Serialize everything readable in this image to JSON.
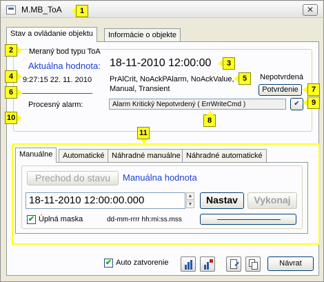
{
  "window": {
    "title": "M.MB_ToA",
    "close_glyph": "✕"
  },
  "callouts": [
    "1",
    "2",
    "3",
    "4",
    "5",
    "6",
    "7",
    "8",
    "9",
    "10",
    "11"
  ],
  "top_tabs": [
    {
      "label": "Stav a ovládanie objektu"
    },
    {
      "label": "Informácie o objekte"
    }
  ],
  "object": {
    "name_label": "Meraný bod typu ToA",
    "actual_label": "Aktuálna hodnota:",
    "actual_value": "18-11-2010 12:00:00",
    "timestamp": "9:27:15 22. 11. 2010",
    "flags_line1": "PrAlCrit, NoAckPAlarm, NoAckValue,",
    "flags_line2": "Manual, Transient",
    "ack_status": "Nepotvrdená",
    "confirm_button": "Potvrdenie",
    "process_alarm_label": "Procesný alarm:",
    "alarm_value": "Alarm Kritický Nepotvrdený ( ErrWriteCmd )",
    "alarm_check_glyph": "✔"
  },
  "bottom_tabs": [
    {
      "label": "Manuálne"
    },
    {
      "label": "Automatické"
    },
    {
      "label": "Náhradné manuálne"
    },
    {
      "label": "Náhradné automatické"
    }
  ],
  "manual": {
    "transition_button": "Prechod do stavu",
    "manual_value_label": "Manuálna hodnota",
    "value_input": "18-11-2010 12:00:00.000",
    "set_button": "Nastav",
    "execute_button": "Vykonaj",
    "full_mask_label": "Úplná maska",
    "full_mask_checked": "✔",
    "format_hint": "dd-mm-rrrr hh:mi:ss.mss"
  },
  "footer": {
    "auto_close_label": "Auto zatvorenie",
    "auto_close_checked": "✔",
    "back_button": "Návrat"
  },
  "colors": {
    "callout": "#ffff20",
    "link_blue": "#1a3fd4",
    "accent": "#3a6ea5"
  }
}
